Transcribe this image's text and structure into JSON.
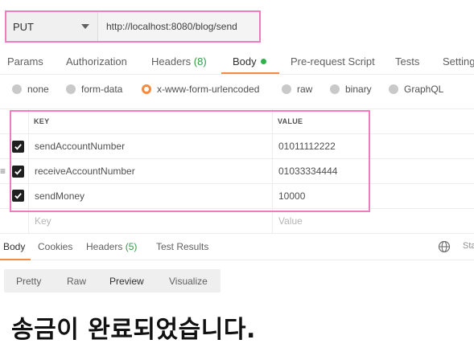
{
  "request": {
    "method": "PUT",
    "url": "http://localhost:8080/blog/send"
  },
  "tabs": {
    "params": "Params",
    "authorization": "Authorization",
    "headers": "Headers",
    "headers_count": "(8)",
    "body": "Body",
    "prerequest": "Pre-request Script",
    "tests": "Tests",
    "settings": "Setting"
  },
  "body_types": {
    "selected": "x-www-form-urlencoded",
    "options": [
      "none",
      "form-data",
      "x-www-form-urlencoded",
      "raw",
      "binary",
      "GraphQL"
    ]
  },
  "params_table": {
    "headers": {
      "key": "KEY",
      "value": "VALUE"
    },
    "rows": [
      {
        "checked": true,
        "key": "sendAccountNumber",
        "value": "01011112222"
      },
      {
        "checked": true,
        "key": "receiveAccountNumber",
        "value": "01033334444"
      },
      {
        "checked": true,
        "key": "sendMoney",
        "value": "10000"
      }
    ],
    "placeholder_key": "Key",
    "placeholder_value": "Value"
  },
  "response_tabs": {
    "body": "Body",
    "cookies": "Cookies",
    "headers": "Headers",
    "headers_count": "(5)",
    "test_results": "Test Results",
    "status_cut": "Sta"
  },
  "view_modes": {
    "pretty": "Pretty",
    "raw": "Raw",
    "preview": "Preview",
    "visualize": "Visualize",
    "active": "Preview"
  },
  "response_body": "송금이 완료되었습니다.",
  "colors": {
    "accent": "#f28c45",
    "highlight": "#f07cbf",
    "count_green": "#2e9b45",
    "dot_green": "#2fb24a"
  }
}
